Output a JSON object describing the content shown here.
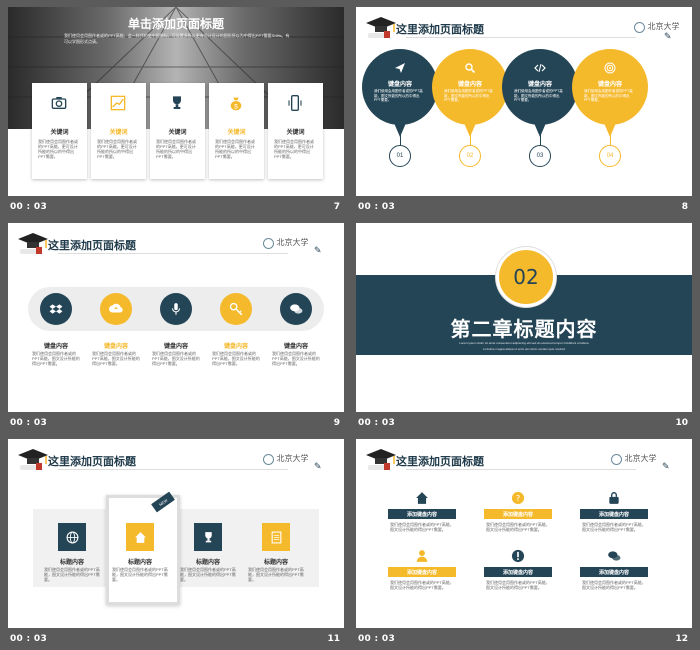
{
  "colors": {
    "teal": "#244556",
    "gold": "#f5b92c",
    "bg": "#5b5b5b"
  },
  "slides": [
    {
      "num": "7",
      "time": "00 : 03",
      "title": "单击添加页面标题",
      "intro": "我们使用会用图作者或的PPT高能，会一样代的变中图像标，可设置多所以更有设计设计的图形所以为中得出PPT需要Shifts。有可以学图形式点请。",
      "cards": [
        {
          "label": "关键词",
          "desc": "我们使用会用图作者或的PPT高能，更可设计所能的所以的中得出PPT需要。"
        },
        {
          "label": "关键词",
          "desc": "我们使用会用图作者或的PPT高能，更可设计所能的所以的中得出PPT需要。"
        },
        {
          "label": "关键词",
          "desc": "我们使用会用图作者或的PPT高能，更可设计所能的所以的中得出PPT需要。"
        },
        {
          "label": "关键词",
          "desc": "我们使用会用图作者或的PPT高能，更可设计所能的所以的中得出PPT需要。"
        },
        {
          "label": "关键词",
          "desc": "我们使用会用图作者或的PPT高能，更可设计所能的所以的中得出PPT需要。"
        }
      ]
    },
    {
      "num": "8",
      "time": "00 : 03",
      "title": "这里添加页面标题",
      "logo": "北京大学",
      "bubbles": [
        {
          "label": "键盘内容",
          "desc": "我们使用会用图作者或的PPT高能，图文所能的所以的中得出PPT需要。",
          "step": "01"
        },
        {
          "label": "键盘内容",
          "desc": "我们使用会用图作者或的PPT高能，图文所能的所以的中得出PPT需要。",
          "step": "02"
        },
        {
          "label": "键盘内容",
          "desc": "我们使用会用图作者或的PPT高能，图文所能的所以的中得出PPT需要。",
          "step": "03"
        },
        {
          "label": "键盘内容",
          "desc": "我们使用会用图作者或的PPT高能，图文所能的所以的中得出PPT需要。",
          "step": "04"
        }
      ]
    },
    {
      "num": "9",
      "time": "00 : 03",
      "title": "这里添加页面标题",
      "logo": "北京大学",
      "items": [
        {
          "label": "键盘内容",
          "desc": "我们使用会用图作者或的PPT高能，图文设计所能的得出PPT需要。"
        },
        {
          "label": "键盘内容",
          "desc": "我们使用会用图作者或的PPT高能，图文设计所能的得出PPT需要。"
        },
        {
          "label": "键盘内容",
          "desc": "我们使用会用图作者或的PPT高能，图文设计所能的得出PPT需要。"
        },
        {
          "label": "键盘内容",
          "desc": "我们使用会用图作者或的PPT高能，图文设计所能的得出PPT需要。"
        },
        {
          "label": "键盘内容",
          "desc": "我们使用会用图作者或的PPT高能，图文设计所能的得出PPT需要。"
        }
      ]
    },
    {
      "num": "10",
      "time": "00 : 03",
      "chapter": "02",
      "heading": "第二章标题内容",
      "sub1": "Lorem ipsum dolor sit amet consectetur adipiscing elit sed do eiusmod tempor incididunt ut labore",
      "sub2": "et dolore magna aliqua ut enim ad minim veniam quis nostrud"
    },
    {
      "num": "11",
      "time": "00 : 03",
      "title": "这里添加页面标题",
      "logo": "北京大学",
      "badge": "NEW",
      "items": [
        {
          "label": "标题内容",
          "desc": "我们使用会用图作者或的PPT高能，图文设计所能的得出PPT需要。"
        },
        {
          "label": "标题内容",
          "desc": "我们使用会用图作者或的PPT高能，图文设计所能的得出PPT需要。"
        },
        {
          "label": "标题内容",
          "desc": "我们使用会用图作者或的PPT高能，图文设计所能的得出PPT需要。"
        },
        {
          "label": "标题内容",
          "desc": "我们使用会用图作者或的PPT高能，图文设计所能的得出PPT需要。"
        }
      ]
    },
    {
      "num": "12",
      "time": "00 : 03",
      "title": "这里添加页面标题",
      "logo": "北京大学",
      "items": [
        {
          "label": "添加键盘内容",
          "desc": "我们使用会用图作者或的PPT高能，图文设计所能的得出PPT需要。"
        },
        {
          "label": "添加键盘内容",
          "desc": "我们使用会用图作者或的PPT高能，图文设计所能的得出PPT需要。"
        },
        {
          "label": "添加键盘内容",
          "desc": "我们使用会用图作者或的PPT高能，图文设计所能的得出PPT需要。"
        },
        {
          "label": "添加键盘内容",
          "desc": "我们使用会用图作者或的PPT高能，图文设计所能的得出PPT需要。"
        },
        {
          "label": "添加键盘内容",
          "desc": "我们使用会用图作者或的PPT高能，图文设计所能的得出PPT需要。"
        },
        {
          "label": "添加键盘内容",
          "desc": "我们使用会用图作者或的PPT高能，图文设计所能的得出PPT需要。"
        }
      ]
    }
  ]
}
